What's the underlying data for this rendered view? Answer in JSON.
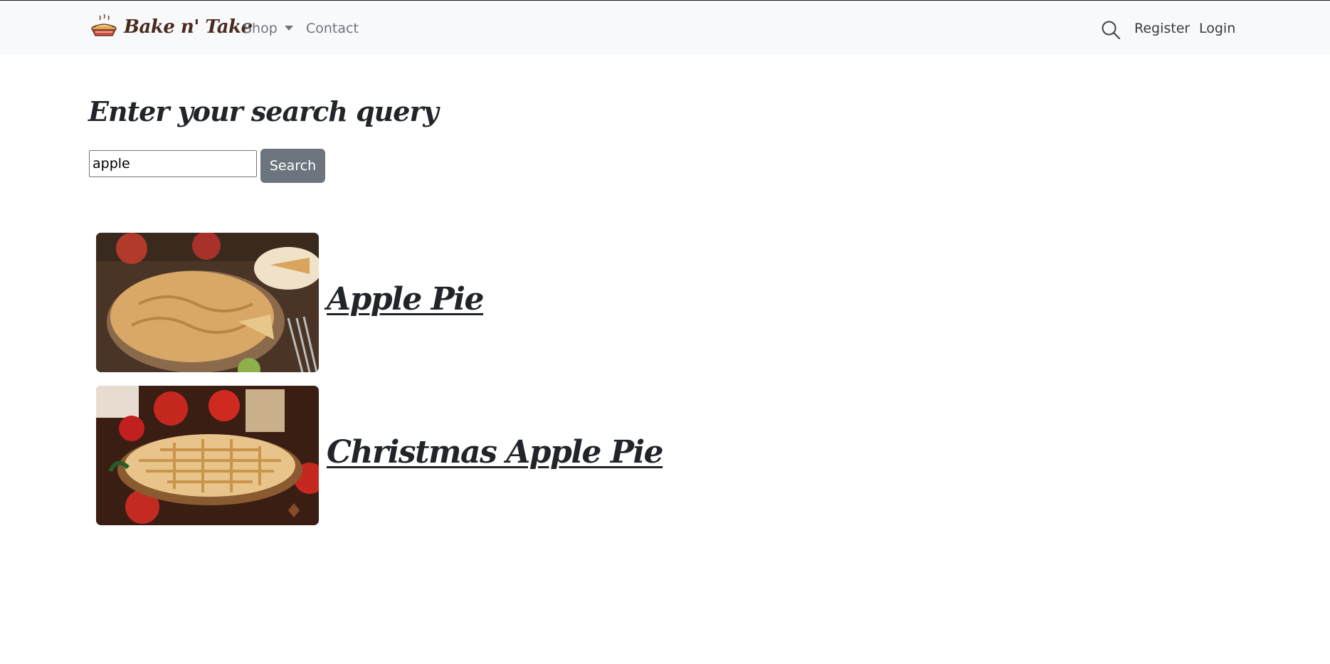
{
  "navbar": {
    "brand": {
      "name": "Bake n' Take",
      "logo_icon": "pie-logo-icon"
    },
    "links": {
      "shop": "Shop",
      "contact": "Contact",
      "register": "Register",
      "login": "Login"
    },
    "icons": {
      "search": "search-icon",
      "shop_dropdown": "caret-down-icon"
    }
  },
  "search": {
    "heading": "Enter your search query",
    "input_value": "apple",
    "button_label": "Search"
  },
  "results": [
    {
      "title": "Apple Pie",
      "image": "apple-pie-image"
    },
    {
      "title": "Christmas Apple Pie",
      "image": "christmas-apple-pie-image"
    }
  ],
  "colors": {
    "navbar_bg": "#f8f9fa",
    "button_bg": "#6c757d",
    "brand": "#4a2a1f",
    "text": "#212529"
  }
}
